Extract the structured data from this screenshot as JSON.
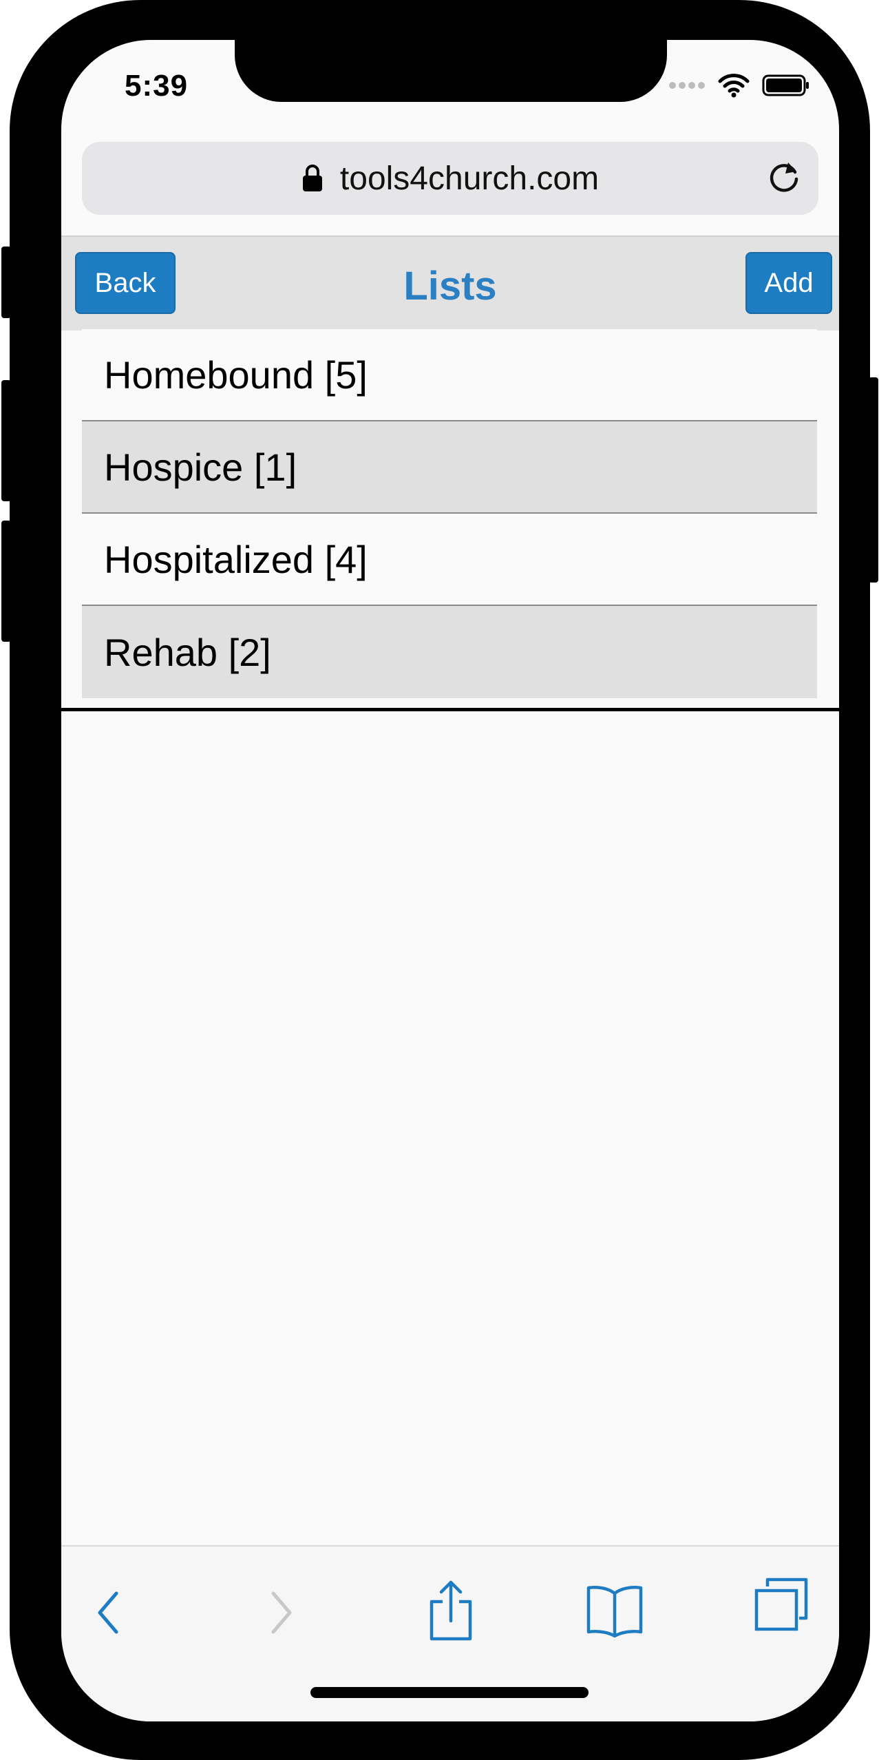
{
  "status_bar": {
    "time": "5:39"
  },
  "browser": {
    "url": "tools4church.com"
  },
  "header": {
    "back_label": "Back",
    "title": "Lists",
    "add_label": "Add"
  },
  "lists": [
    {
      "label": "Homebound [5]"
    },
    {
      "label": "Hospice [1]"
    },
    {
      "label": "Hospitalized [4]"
    },
    {
      "label": "Rehab [2]"
    }
  ],
  "colors": {
    "accent": "#1e7cc2",
    "title": "#2b7fc3",
    "row_alt": "#e0e0e0",
    "header_bg": "#e2e2e2"
  },
  "icons": {
    "status": [
      "cellular-dots-icon",
      "wifi-icon",
      "battery-icon"
    ],
    "url": [
      "lock-icon",
      "reload-icon"
    ],
    "toolbar": [
      "back-chevron-icon",
      "forward-chevron-icon",
      "share-icon",
      "bookmarks-icon",
      "tabs-icon"
    ]
  }
}
